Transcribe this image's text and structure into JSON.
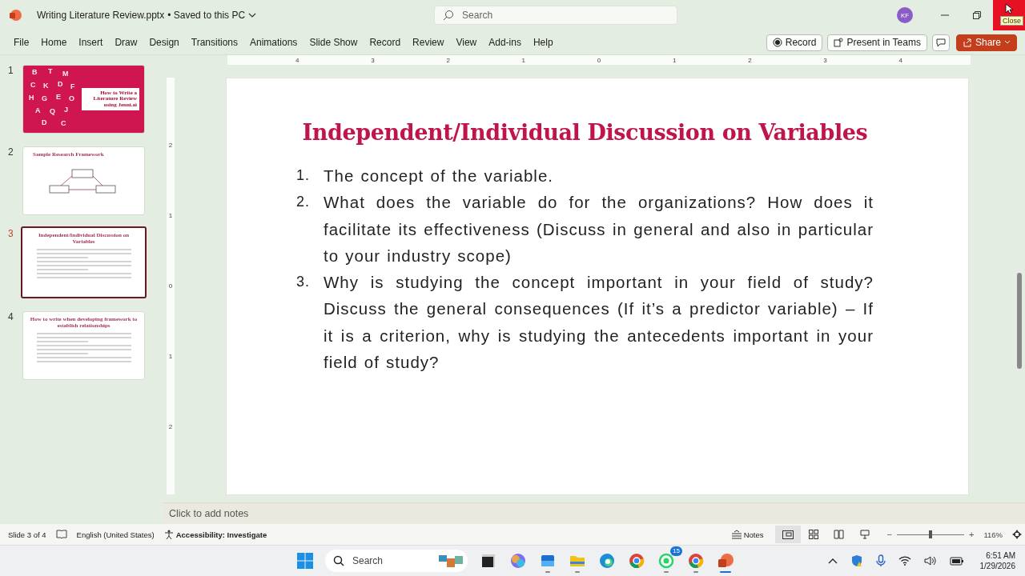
{
  "title_bar": {
    "file_name": "Writing Literature Review.pptx",
    "save_status": "• Saved to this PC",
    "search_placeholder": "Search",
    "avatar": "KF",
    "tooltip": "Close"
  },
  "ribbon_tabs": [
    {
      "label": "File",
      "selected": false
    },
    {
      "label": "Home",
      "selected": false
    },
    {
      "label": "Insert",
      "selected": false
    },
    {
      "label": "Draw",
      "selected": false
    },
    {
      "label": "Design",
      "selected": false
    },
    {
      "label": "Transitions",
      "selected": false
    },
    {
      "label": "Animations",
      "selected": false
    },
    {
      "label": "Slide Show",
      "selected": false
    },
    {
      "label": "Record",
      "selected": false
    },
    {
      "label": "Review",
      "selected": false
    },
    {
      "label": "View",
      "selected": false
    },
    {
      "label": "Add-ins",
      "selected": false
    },
    {
      "label": "Help",
      "selected": false
    }
  ],
  "ribbon_buttons": [
    {
      "kind": "record",
      "label": "Record"
    },
    {
      "kind": "teams",
      "label": "Present in Teams"
    },
    {
      "kind": "comment"
    },
    {
      "kind": "share",
      "label": "Share"
    }
  ],
  "ruler": {
    "labels": [
      "4",
      "3",
      "2",
      "1",
      "0",
      "1",
      "2",
      "3",
      "4"
    ],
    "vertical_labels": [
      "2",
      "1",
      "0",
      "1",
      "2"
    ]
  },
  "thumbnails": [
    {
      "number": "1",
      "kind": "cover",
      "selected": false,
      "title": "How to Write a Literature Review using Jenni.ai",
      "letters": [
        "B",
        "T",
        "M",
        "C",
        "K",
        "D",
        "F",
        "H",
        "G",
        "E",
        "O",
        "A",
        "Q",
        "J",
        "D",
        "C"
      ]
    },
    {
      "number": "2",
      "kind": "diagram",
      "selected": false,
      "title": "Sample Research Framework"
    },
    {
      "number": "3",
      "kind": "numbered",
      "selected": true,
      "title": "Independent/Individual Discussion on Variables"
    },
    {
      "number": "4",
      "kind": "bulleted",
      "selected": false,
      "title": "How to write when developing framework to establish relationships"
    }
  ],
  "slide": {
    "title": "Independent/Individual Discussion on Variables",
    "items": [
      {
        "number": "1.",
        "text": "The concept of the variable."
      },
      {
        "number": "2.",
        "text": "What does the variable do for the organizations? How does it facilitate its effectiveness (Discuss in general and also in particular to your industry scope)"
      },
      {
        "number": "3.",
        "text": "Why is studying the concept important in your field of study? Discuss the general consequences (If it’s a predictor variable) – If it is a criterion, why is studying the antecedents important in your field of study?"
      }
    ]
  },
  "notes_placeholder": "Click to add notes",
  "status_bar": {
    "slide_info": "Slide 3 of 4",
    "language": "English (United States)",
    "accessibility": "Accessibility: Investigate",
    "notes": "Notes",
    "views": [
      {
        "kind": "normal",
        "selected": true
      },
      {
        "kind": "sorter",
        "selected": false
      },
      {
        "kind": "reading",
        "selected": false
      },
      {
        "kind": "show",
        "selected": false
      }
    ],
    "zoom": {
      "out_label": "−",
      "level": 0.5,
      "in_label": "+",
      "reading": "116%"
    }
  },
  "taskbar": {
    "search_placeholder": "Search",
    "apps": [
      {
        "kind": "terminal",
        "running": false
      },
      {
        "kind": "copilot",
        "running": false
      },
      {
        "kind": "outlook",
        "running": true
      },
      {
        "kind": "folder",
        "running": true
      },
      {
        "kind": "edge",
        "running": false
      },
      {
        "kind": "chrome",
        "running": false
      },
      {
        "kind": "whatsapp",
        "running": true,
        "badge": "15"
      },
      {
        "kind": "chrome",
        "running": true
      },
      {
        "kind": "powerpoint",
        "running": true
      }
    ],
    "time": "6:51 AM",
    "date": "1/29/2026"
  }
}
